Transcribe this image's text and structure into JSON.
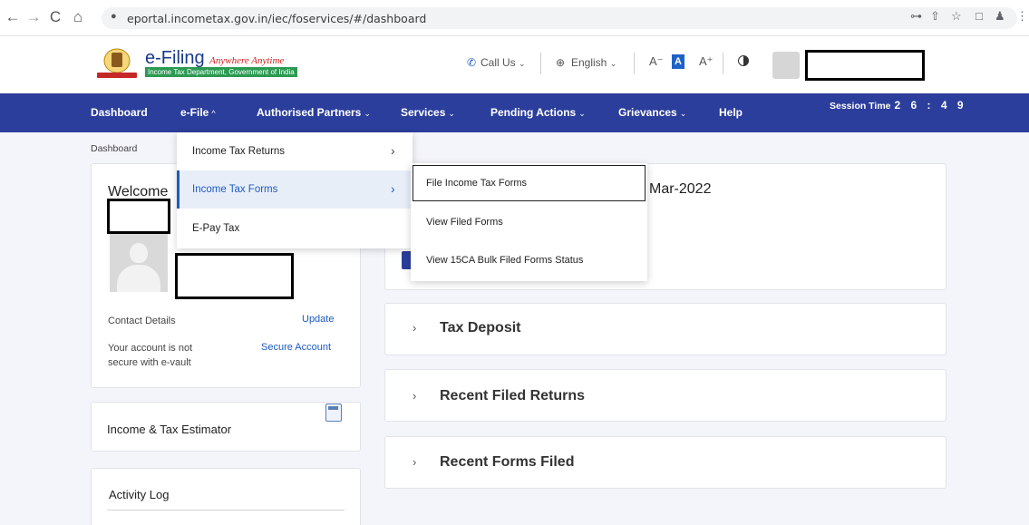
{
  "browser": {
    "url": "eportal.incometax.gov.in/iec/foservices/#/dashboard",
    "back_icon": "←",
    "forward_icon": "→",
    "reload_icon": "C",
    "home_icon": "⌂",
    "lock_icon": "🔒",
    "key_icon": "⊶",
    "share_icon": "⇧",
    "star_icon": "☆",
    "sidepanel_icon": "□",
    "profile_icon": "♟",
    "menu_icon": "⋮"
  },
  "header": {
    "brand_main": "e-Filing",
    "brand_tagline": "Anywhere Anytime",
    "brand_sub": "Income Tax Department, Government of India",
    "call_us": "Call Us",
    "phone_icon": "✆",
    "language": "English",
    "globe_icon": "⊕",
    "font_decrease": "A⁻",
    "font_default": "A",
    "font_increase": "A⁺"
  },
  "nav": {
    "items": [
      {
        "label": "Dashboard",
        "dropdown": false
      },
      {
        "label": "e-File",
        "dropdown": true
      },
      {
        "label": "Authorised Partners",
        "dropdown": true
      },
      {
        "label": "Services",
        "dropdown": true
      },
      {
        "label": "Pending Actions",
        "dropdown": true
      },
      {
        "label": "Grievances",
        "dropdown": true
      },
      {
        "label": "Help",
        "dropdown": false
      }
    ],
    "session_label": "Session Time",
    "session_time": "2 6 : 4 9",
    "chevron_down": "⌄",
    "chevron_up": "^"
  },
  "breadcrumb": "Dashboard",
  "profile": {
    "welcome": "Welcome",
    "contact_details": "Contact Details",
    "update": "Update",
    "security_note": "Your account is not secure with e-vault",
    "secure_account": "Secure Account"
  },
  "estimator": {
    "label": "Income & Tax Estimator"
  },
  "activity": {
    "label": "Activity Log"
  },
  "main": {
    "partial_date": "Mar-2022",
    "accordions": [
      {
        "title": "Tax Deposit"
      },
      {
        "title": "Recent Filed Returns"
      },
      {
        "title": "Recent Forms Filed"
      }
    ],
    "chevron_right": "›"
  },
  "efile_menu": {
    "items": [
      {
        "label": "Income Tax Returns",
        "active": false,
        "has_submenu": true
      },
      {
        "label": "Income Tax Forms",
        "active": true,
        "has_submenu": true
      },
      {
        "label": "E-Pay Tax",
        "active": false,
        "has_submenu": false
      }
    ],
    "arrow": "›"
  },
  "forms_submenu": {
    "items": [
      {
        "label": "File Income Tax Forms",
        "highlighted": true
      },
      {
        "label": "View Filed Forms",
        "highlighted": false
      },
      {
        "label": "View 15CA Bulk Filed Forms Status",
        "highlighted": false
      }
    ]
  }
}
